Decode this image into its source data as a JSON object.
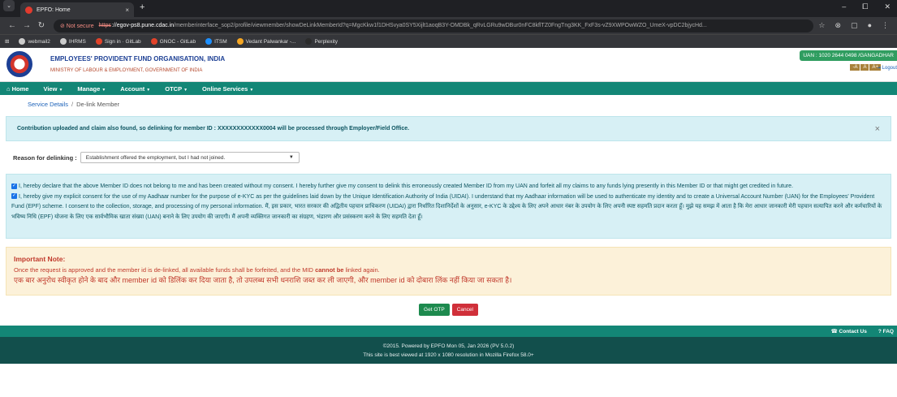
{
  "browser": {
    "tab_title": "EPFO: Home",
    "tab_close": "×",
    "new_tab": "+",
    "window_controls": [
      "–",
      "⧠",
      "✕"
    ],
    "not_secure": "⊘ Not secure",
    "url_scheme": "https",
    "url_host": "://egov-ps8.pune.cdac.in",
    "url_path": "/memberinterface_sop2/profile/viewmember/showDeLinkMemberId?q=MgcKkw1f1DHSvya0SY5Xijlt1aoqB3Y-OMDBk_qRvLGRu9wDBur0nFC8kflTZ0FngTng3KK_FxF3s-vZ9XWPOwWZO_UmeX-vpDC2bjycHd...",
    "bookmarks": [
      {
        "label": "webmail2",
        "color": "#cccccc"
      },
      {
        "label": "IHRMS",
        "color": "#cccccc"
      },
      {
        "label": "Sign in · GitLab",
        "color": "#e2432a"
      },
      {
        "label": "GNOC - GitLab",
        "color": "#e2432a"
      },
      {
        "label": "ITSM",
        "color": "#1e90ff"
      },
      {
        "label": "Vedant Palwankar -...",
        "color": "#f5a623"
      },
      {
        "label": "Perplexity",
        "color": "#2b2b2b"
      }
    ]
  },
  "header": {
    "org_name": "EMPLOYEES' PROVIDENT FUND ORGANISATION, INDIA",
    "ministry": "MINISTRY OF LABOUR & EMPLOYMENT, GOVERNMENT OF INDIA",
    "uan": "UAN : 1020 2644 0498 /GANGADHAR",
    "font_buttons": [
      "-A",
      "A",
      "A+"
    ],
    "logout": "⇥ Logout"
  },
  "nav": {
    "items": [
      "Home",
      "View",
      "Manage",
      "Account",
      "OTCP",
      "Online Services"
    ]
  },
  "breadcrumb": {
    "parent": "Service Details",
    "separator": "/",
    "current": "De-link Member"
  },
  "info_alert": {
    "text": "Contribution uploaded and claim also found, so delinking for member ID : XXXXXXXXXXXX0004 will be processed through Employer/Field Office.",
    "close": "×"
  },
  "reason": {
    "label": "Reason for delinking :",
    "selected": "Establishment offered the employment, but I had not joined."
  },
  "consent": {
    "declaration": "I, hereby declare that the above Member ID does not belong to me and has been created without my consent. I hereby further give my consent to delink this erroneously created Member ID from my UAN and forfeit all my claims to any funds lying presently in this Member ID or that might get credited in future.",
    "aadhaar_en": "I, hereby give my explicit consent for the use of my Aadhaar number for the purpose of e-KYC as per the guidelines laid down by the Unique Identification Authority of India (UIDAI). I understand that my Aadhaar information will be used to authenticate my identity and to create a Universal Account Number (UAN) for the Employees' Provident Fund (EPF) scheme. I consent to the collection, storage, and processing of my personal information.",
    "aadhaar_hi": "मैं, इस प्रकार, भारत सरकार की अद्वितीय पहचान प्राधिकरण (UIDAI) द्वारा निर्धारित दिशानिर्देशों के अनुसार, e-KYC के उद्देश्य के लिए अपने आधार नंबर के उपयोग के लिए अपनी स्पष्ट सहमति प्रदान करता हूँ। मुझे यह समझ में आता है कि मेरा आधार जानकारी मेरी पहचान सत्यापित करने और कर्मचारियों के भविष्य निधि (EPF) योजना के लिए एक सार्वभौमिक खाता संख्या (UAN) बनाने के लिए उपयोग की जाएगी। मैं अपनी व्यक्तिगत जानकारी का संग्रहण, भंडारण और प्रसंस्करण करने के लिए सहमति देता हूँ।"
  },
  "important": {
    "heading": "Important Note:",
    "text_before": "Once the request is approved and the member id is de-linked, all available funds shall be forfeited, and the MID",
    "text_bold": "cannot be",
    "text_after": "linked again.",
    "hindi": "एक बार अनुरोध स्वीकृत होने के बाद और member id को डिलिंक कर दिया जाता है, तो उपलब्ध सभी धनराशि जब्त कर ली जाएगी, और member id को दोबारा लिंक नहीं किया जा सकता है।"
  },
  "actions": {
    "get_otp": "Get OTP",
    "cancel": "Cancel"
  },
  "footer": {
    "contact": "Contact Us",
    "faq": "FAQ",
    "copyright": "©2015. Powered by EPFO Mon 05, Jan 2026 (PV 5.0.2)",
    "best_viewed": "This site is best viewed at 1920 x 1080 resolution in Mozilla Firefox 58.0+"
  }
}
